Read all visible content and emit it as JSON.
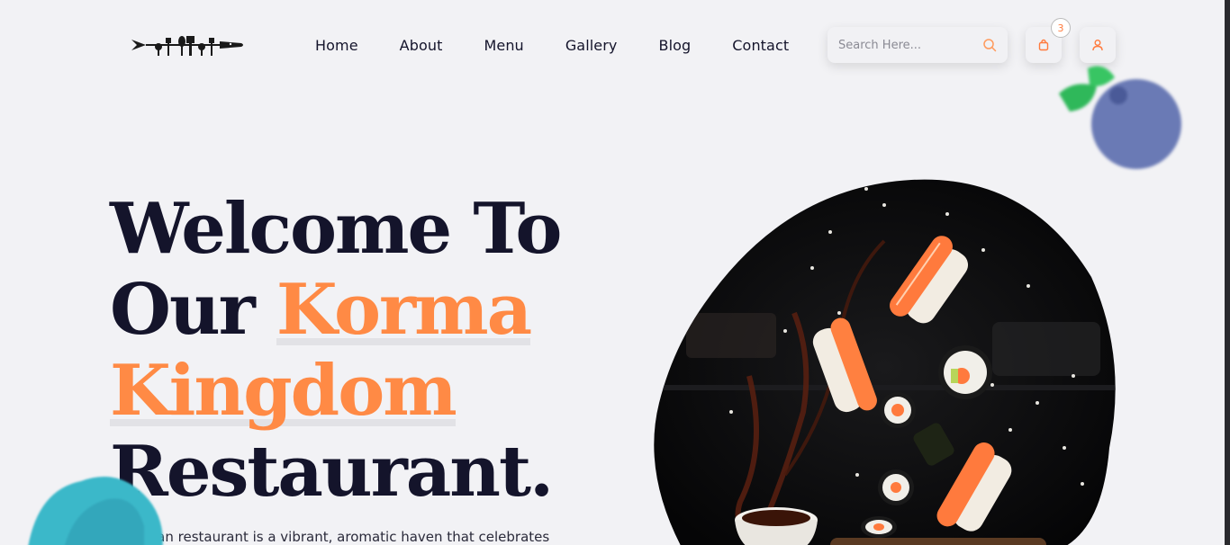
{
  "header": {
    "nav": [
      "Home",
      "About",
      "Menu",
      "Gallery",
      "Blog",
      "Contact"
    ],
    "search_placeholder": "Search Here...",
    "cart_count": "3"
  },
  "hero": {
    "line1": "Welcome To",
    "line2_plain": "Our ",
    "line2_accent": "Korma",
    "line3_accent": "Kingdom",
    "line4": "Restaurant.",
    "description": "An Indian restaurant is a vibrant, aromatic haven that celebrates"
  },
  "colors": {
    "accent": "#ff8a45",
    "text": "#14142b",
    "background": "#f2f2f5"
  },
  "icons": [
    "logo-cutlery-icon",
    "search-icon",
    "shopping-bag-icon",
    "user-icon"
  ]
}
